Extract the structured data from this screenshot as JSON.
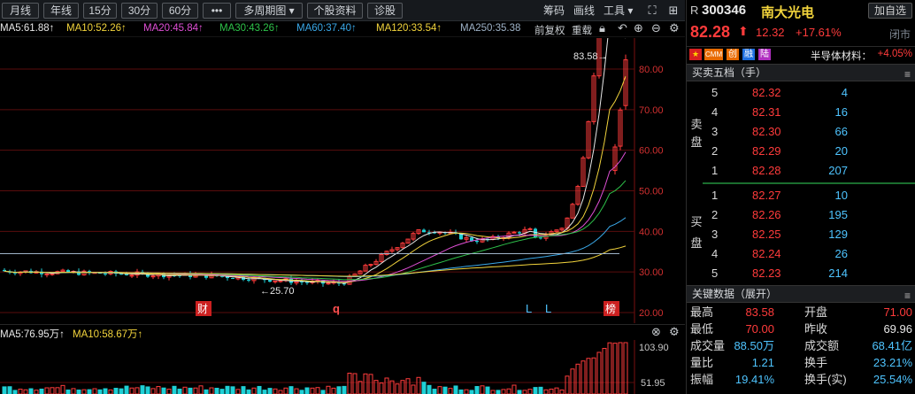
{
  "toolbar": {
    "buttons": [
      "月线",
      "年线",
      "15分",
      "30分",
      "60分",
      "•••",
      "多周期图 ▾",
      "个股资料",
      "诊股"
    ],
    "right_items": [
      "筹码",
      "画线",
      "工具 ▾"
    ]
  },
  "ma_legend": [
    {
      "label": "MA5:61.88↑",
      "color": "#e8e8e8"
    },
    {
      "label": "MA10:52.26↑",
      "color": "#f2d43c"
    },
    {
      "label": "MA20:45.84↑",
      "color": "#e04fd6"
    },
    {
      "label": "MA30:43.26↑",
      "color": "#2ec24a"
    },
    {
      "label": "MA60:37.40↑",
      "color": "#3aa8e8"
    },
    {
      "label": "MA120:33.54↑",
      "color": "#f2d43c"
    },
    {
      "label": "MA250:35.38",
      "color": "#9fb3c8"
    }
  ],
  "chart_controls": {
    "fq": "前复权",
    "refresh": "重载"
  },
  "price_axis": [
    "80.00",
    "70.00",
    "60.00",
    "50.00",
    "40.00",
    "30.00",
    "20.00"
  ],
  "price_labels": {
    "high": "83.58→",
    "low": "←25.70"
  },
  "markers": {
    "cai": "财",
    "q": "q",
    "l1": "L",
    "l2": "L",
    "bang": "榜"
  },
  "volume": {
    "ma5": "MA5:76.95万↑",
    "ma10": "MA10:58.67万↑",
    "axis": [
      "103.90",
      "51.95"
    ]
  },
  "stock": {
    "prefix": "R",
    "code": "300346",
    "name": "南大光电",
    "watch_button": "加自选",
    "price": "82.28",
    "arrow": "⬆",
    "change": "12.32",
    "change_pct": "+17.61%",
    "status": "闭市"
  },
  "tags": {
    "flag": "flag-icon",
    "items": [
      "CMM",
      "创",
      "融",
      "陆"
    ],
    "sector": "半导体材料：",
    "sector_change": "+4.05%"
  },
  "orderbook": {
    "title": "买卖五档（手）",
    "sell_label": [
      "卖",
      "盘"
    ],
    "buy_label": [
      "买",
      "盘"
    ],
    "sells": [
      {
        "level": "5",
        "price": "82.32",
        "vol": "4"
      },
      {
        "level": "4",
        "price": "82.31",
        "vol": "16"
      },
      {
        "level": "3",
        "price": "82.30",
        "vol": "66"
      },
      {
        "level": "2",
        "price": "82.29",
        "vol": "20"
      },
      {
        "level": "1",
        "price": "82.28",
        "vol": "207"
      }
    ],
    "buys": [
      {
        "level": "1",
        "price": "82.27",
        "vol": "10"
      },
      {
        "level": "2",
        "price": "82.26",
        "vol": "195"
      },
      {
        "level": "3",
        "price": "82.25",
        "vol": "129"
      },
      {
        "level": "4",
        "price": "82.24",
        "vol": "26"
      },
      {
        "level": "5",
        "price": "82.23",
        "vol": "214"
      }
    ]
  },
  "key_data": {
    "title": "关键数据（展开）",
    "rows": [
      {
        "k1": "最高",
        "v1": "83.58",
        "c1": "red",
        "k2": "开盘",
        "v2": "71.00",
        "c2": "red"
      },
      {
        "k1": "最低",
        "v1": "70.00",
        "c1": "red",
        "k2": "昨收",
        "v2": "69.96",
        "c2": "white"
      },
      {
        "k1": "成交量",
        "v1": "88.50万",
        "c1": "cyan",
        "k2": "成交额",
        "v2": "68.41亿",
        "c2": "cyan"
      },
      {
        "k1": "量比",
        "v1": "1.21",
        "c1": "cyan",
        "k2": "换手",
        "v2": "23.21%",
        "c2": "cyan"
      },
      {
        "k1": "振幅",
        "v1": "19.41%",
        "c1": "cyan",
        "k2": "换手(实)",
        "v2": "25.54%",
        "c2": "cyan"
      }
    ]
  },
  "colors": {
    "up": "#ff3b3b",
    "down": "#1fd0d6",
    "grid": "#5a0d0d"
  }
}
